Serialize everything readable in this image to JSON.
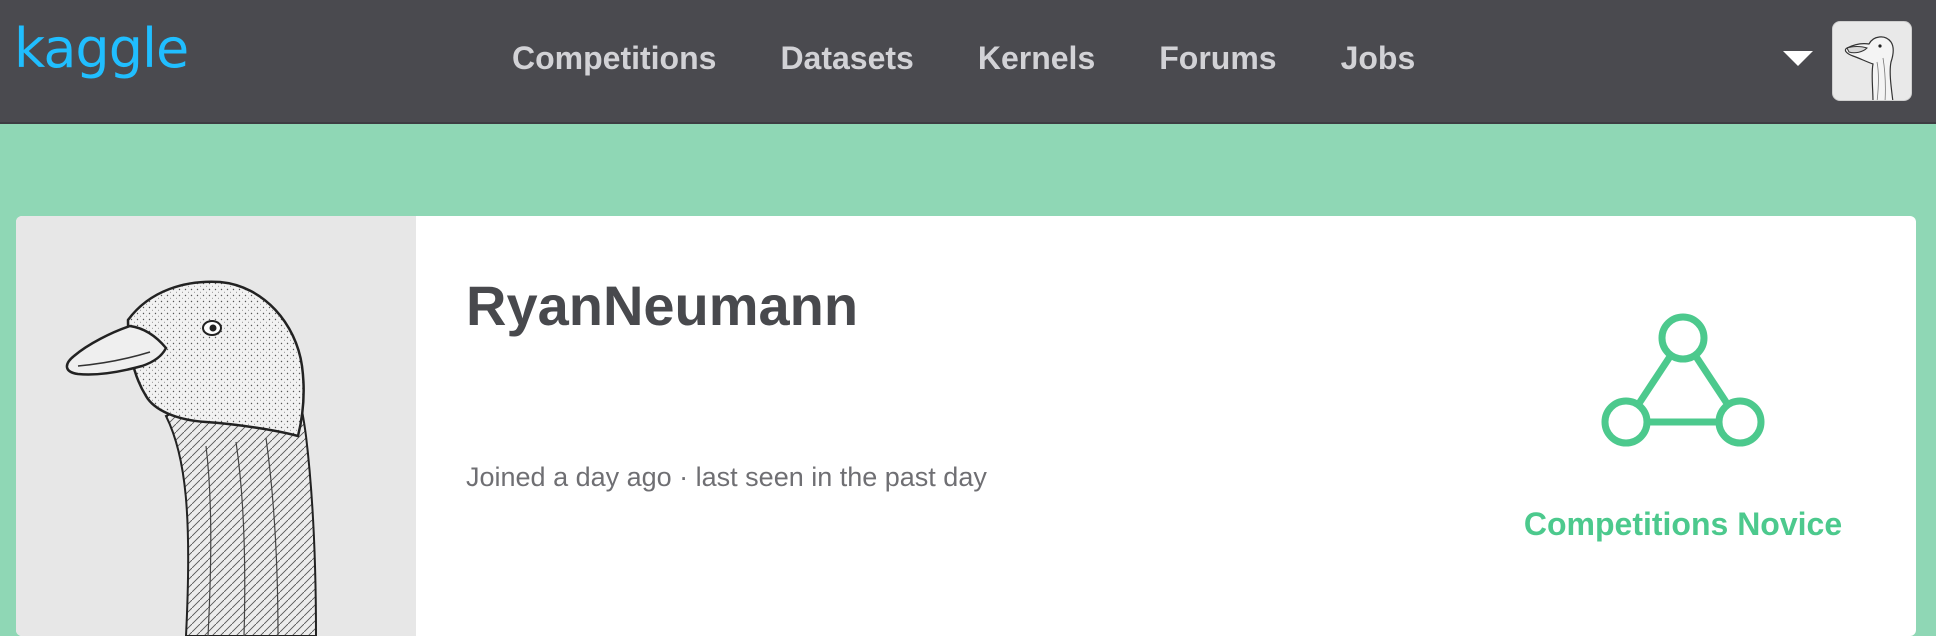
{
  "header": {
    "logo_text": "kaggle",
    "nav": [
      {
        "label": "Competitions"
      },
      {
        "label": "Datasets"
      },
      {
        "label": "Kernels"
      },
      {
        "label": "Forums"
      },
      {
        "label": "Jobs"
      }
    ],
    "menu_icon": "caret-down-icon",
    "avatar_icon": "goose-avatar"
  },
  "profile": {
    "username": "RyanNeumann",
    "joined_text": "Joined a day ago · last seen in the past day",
    "photo_icon": "goose-portrait",
    "tier": {
      "label": "Competitions Novice",
      "icon": "novice-tier-icon"
    }
  },
  "colors": {
    "navbar_bg": "#4a4a4f",
    "page_bg": "#8fd7b5",
    "logo": "#20beff",
    "tier_green": "#4cc98d"
  }
}
